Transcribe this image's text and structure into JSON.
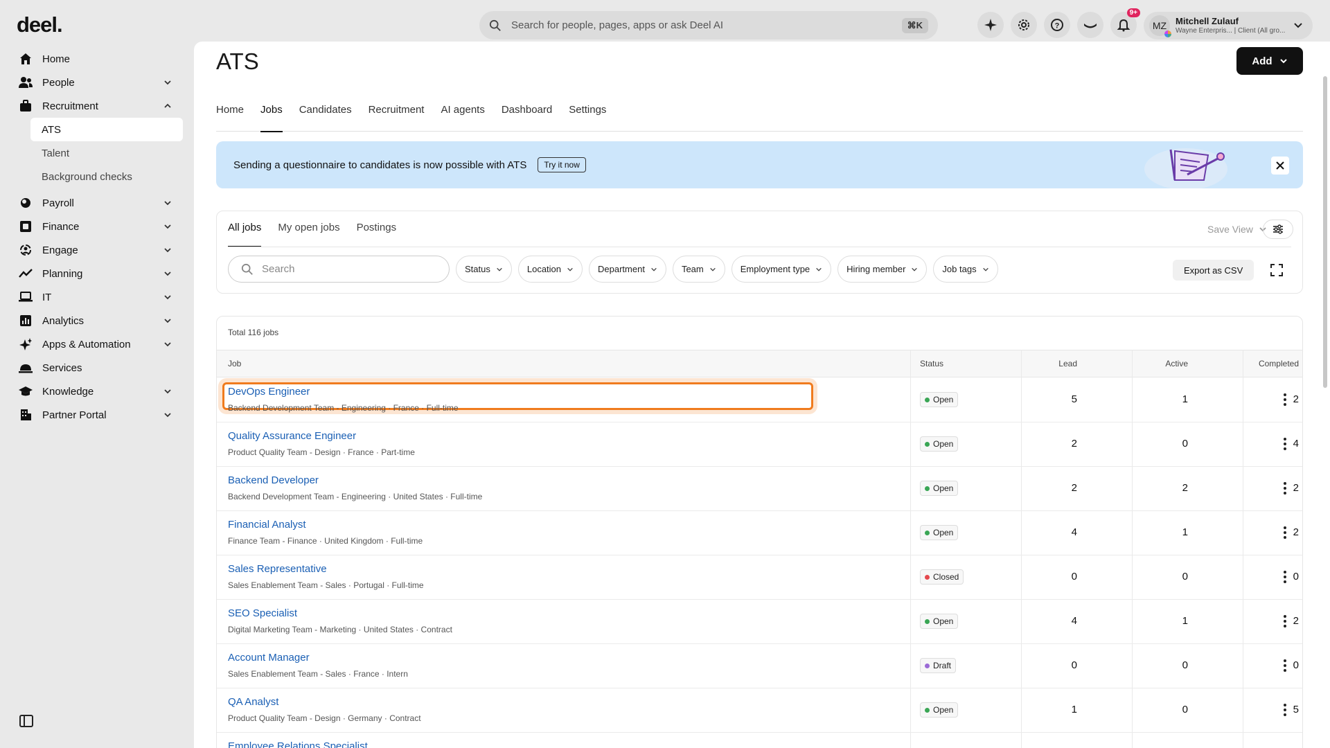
{
  "app": {
    "logo": "deel.",
    "search_placeholder": "Search for people, pages, apps or ask Deel AI",
    "search_shortcut": "⌘K",
    "notifications_badge": "9+",
    "user": {
      "initials": "MZ",
      "name": "Mitchell Zulauf",
      "subtitle": "Wayne Enterpris... | Client (All gro..."
    }
  },
  "sidebar": {
    "items": [
      {
        "label": "Home",
        "icon": "home-icon",
        "chevron": false
      },
      {
        "label": "People",
        "icon": "people-icon",
        "chevron": "down"
      },
      {
        "label": "Recruitment",
        "icon": "briefcase-icon",
        "chevron": "up"
      },
      {
        "label": "Payroll",
        "icon": "payroll-icon",
        "chevron": "down"
      },
      {
        "label": "Finance",
        "icon": "finance-icon",
        "chevron": "down"
      },
      {
        "label": "Engage",
        "icon": "engage-icon",
        "chevron": "down"
      },
      {
        "label": "Planning",
        "icon": "planning-icon",
        "chevron": "down"
      },
      {
        "label": "IT",
        "icon": "laptop-icon",
        "chevron": "down"
      },
      {
        "label": "Analytics",
        "icon": "analytics-icon",
        "chevron": "down"
      },
      {
        "label": "Apps & Automation",
        "icon": "sparkle-icon",
        "chevron": "down"
      },
      {
        "label": "Services",
        "icon": "services-icon",
        "chevron": false
      },
      {
        "label": "Knowledge",
        "icon": "knowledge-icon",
        "chevron": "down"
      },
      {
        "label": "Partner Portal",
        "icon": "building-icon",
        "chevron": "down"
      }
    ],
    "recruitment_sub": [
      "ATS",
      "Talent",
      "Background checks"
    ]
  },
  "page": {
    "title": "ATS",
    "add_label": "Add",
    "tabs": [
      "Home",
      "Jobs",
      "Candidates",
      "Recruitment",
      "AI agents",
      "Dashboard",
      "Settings"
    ],
    "active_tab": "Jobs"
  },
  "banner": {
    "text": "Sending a questionnaire to candidates is now possible with ATS",
    "cta": "Try it now"
  },
  "filters": {
    "subtabs": [
      "All jobs",
      "My open jobs",
      "Postings"
    ],
    "save_view": "Save View",
    "search_placeholder": "Search",
    "pills": [
      "Status",
      "Location",
      "Department",
      "Team",
      "Employment type",
      "Hiring member",
      "Job tags"
    ],
    "export": "Export as CSV"
  },
  "table": {
    "total": "Total 116 jobs",
    "headers": {
      "job": "Job",
      "status": "Status",
      "lead": "Lead",
      "active": "Active",
      "completed": "Completed"
    },
    "rows": [
      {
        "title": "DevOps Engineer",
        "sub": "Backend Development Team - Engineering · France · Full-time",
        "status": "Open",
        "lead": "5",
        "active": "1",
        "completed": "2"
      },
      {
        "title": "Quality Assurance Engineer",
        "sub": "Product Quality Team - Design · France · Part-time",
        "status": "Open",
        "lead": "2",
        "active": "0",
        "completed": "4"
      },
      {
        "title": "Backend Developer",
        "sub": "Backend Development Team - Engineering · United States · Full-time",
        "status": "Open",
        "lead": "2",
        "active": "2",
        "completed": "2"
      },
      {
        "title": "Financial Analyst",
        "sub": "Finance Team - Finance · United Kingdom · Full-time",
        "status": "Open",
        "lead": "4",
        "active": "1",
        "completed": "2"
      },
      {
        "title": "Sales Representative",
        "sub": "Sales Enablement Team - Sales · Portugal · Full-time",
        "status": "Closed",
        "lead": "0",
        "active": "0",
        "completed": "0"
      },
      {
        "title": "SEO Specialist",
        "sub": "Digital Marketing Team - Marketing · United States · Contract",
        "status": "Open",
        "lead": "4",
        "active": "1",
        "completed": "2"
      },
      {
        "title": "Account Manager",
        "sub": "Sales Enablement Team - Sales · France · Intern",
        "status": "Draft",
        "lead": "0",
        "active": "0",
        "completed": "0"
      },
      {
        "title": "QA Analyst",
        "sub": "Product Quality Team - Design · Germany · Contract",
        "status": "Open",
        "lead": "1",
        "active": "0",
        "completed": "5"
      },
      {
        "title": "Employee Relations Specialist",
        "sub": "",
        "status": "",
        "lead": "",
        "active": "",
        "completed": ""
      }
    ]
  },
  "colors": {
    "open": "#3aa655",
    "closed": "#e5484d",
    "draft": "#9b6bd6",
    "link": "#1a5fb4",
    "highlight": "#f07b1d"
  }
}
